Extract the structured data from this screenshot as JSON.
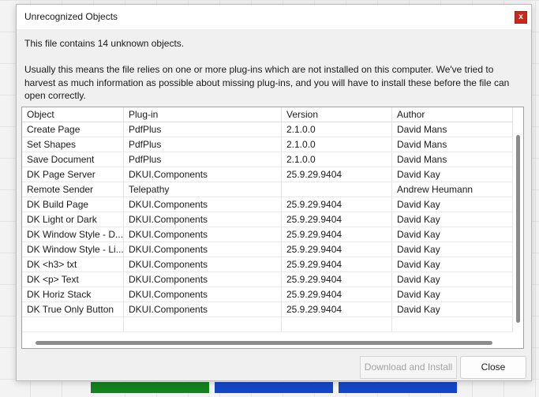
{
  "dialog": {
    "title": "Unrecognized Objects",
    "close_glyph": "x",
    "message_summary": "This file contains 14 unknown objects.",
    "message_detail": "Usually this means the file relies on one or more plug-ins which are not installed on this computer. We've tried to harvest as much information as possible about missing plug-ins, and you will have to install these before the file can open correctly.",
    "download_label": "Download and Install",
    "close_label": "Close"
  },
  "table": {
    "columns": [
      "Object",
      "Plug-in",
      "Version",
      "Author"
    ],
    "rows": [
      {
        "object": "Create Page",
        "plugin": "PdfPlus",
        "version": "2.1.0.0",
        "author": "David Mans"
      },
      {
        "object": "Set Shapes",
        "plugin": "PdfPlus",
        "version": "2.1.0.0",
        "author": "David Mans"
      },
      {
        "object": "Save Document",
        "plugin": "PdfPlus",
        "version": "2.1.0.0",
        "author": "David Mans"
      },
      {
        "object": "DK Page Server",
        "plugin": "DKUI.Components",
        "version": "25.9.29.9404",
        "author": "David Kay"
      },
      {
        "object": "Remote Sender",
        "plugin": "Telepathy",
        "version": "",
        "author": "Andrew Heumann"
      },
      {
        "object": "DK Build Page",
        "plugin": "DKUI.Components",
        "version": "25.9.29.9404",
        "author": "David Kay"
      },
      {
        "object": "DK Light or Dark",
        "plugin": "DKUI.Components",
        "version": "25.9.29.9404",
        "author": "David Kay"
      },
      {
        "object": "DK Window Style - D...",
        "plugin": "DKUI.Components",
        "version": "25.9.29.9404",
        "author": "David Kay"
      },
      {
        "object": "DK Window Style - Li...",
        "plugin": "DKUI.Components",
        "version": "25.9.29.9404",
        "author": "David Kay"
      },
      {
        "object": "DK <h3> txt",
        "plugin": "DKUI.Components",
        "version": "25.9.29.9404",
        "author": "David Kay"
      },
      {
        "object": "DK <p> Text",
        "plugin": "DKUI.Components",
        "version": "25.9.29.9404",
        "author": "David Kay"
      },
      {
        "object": "DK Horiz Stack",
        "plugin": "DKUI.Components",
        "version": "25.9.29.9404",
        "author": "David Kay"
      },
      {
        "object": "DK True Only Button",
        "plugin": "DKUI.Components",
        "version": "25.9.29.9404",
        "author": "David Kay"
      }
    ]
  },
  "colors": {
    "close_button": "#c42b1c",
    "background_green": "#14821e",
    "background_blue": "#1446c8"
  }
}
